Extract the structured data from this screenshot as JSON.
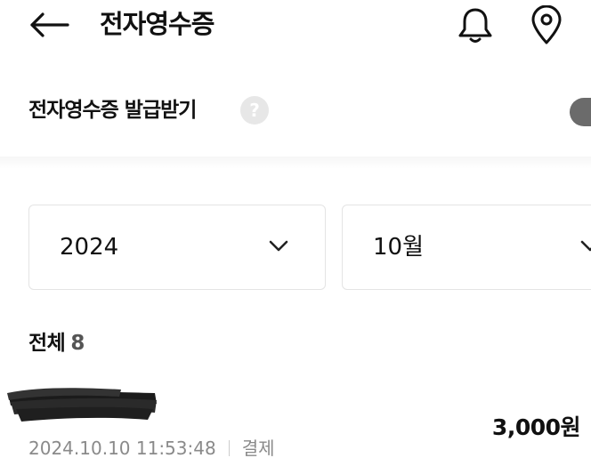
{
  "header": {
    "title": "전자영수증",
    "icons": {
      "back": "arrow-left-icon",
      "notifications": "bell-icon",
      "location": "map-pin-icon"
    }
  },
  "receipt_toggle": {
    "label": "전자영수증 발급받기",
    "help_glyph": "?",
    "enabled": true,
    "toggle_color": "#6b6b6b"
  },
  "filters": {
    "year": "2024",
    "month": "10월"
  },
  "list": {
    "label": "전체",
    "count": "8",
    "items": [
      {
        "merchant": "",
        "amount": "3,000원",
        "datetime": "2024.10.10 11:53:48",
        "type": "결제"
      }
    ]
  }
}
